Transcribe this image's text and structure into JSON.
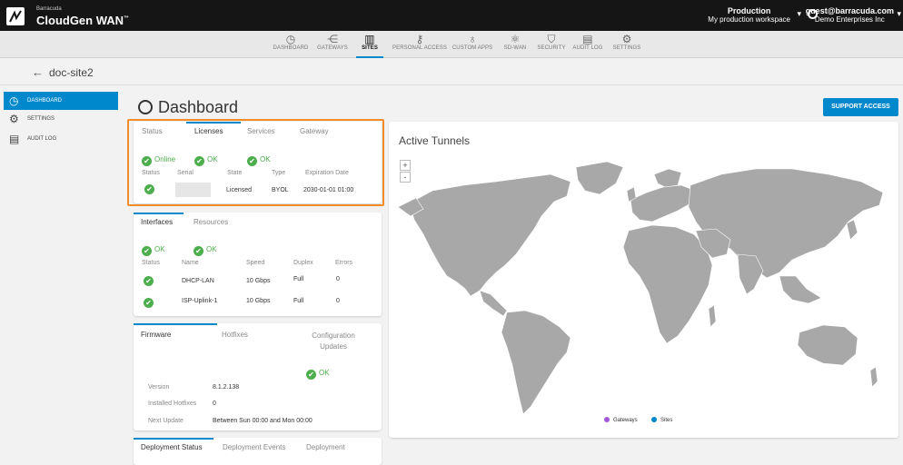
{
  "app": {
    "brand_small": "Barracuda",
    "name": "CloudGen WAN",
    "trademark": "™"
  },
  "workspace": {
    "title": "Production",
    "subtitle": "My production workspace"
  },
  "user": {
    "email": "guest@barracuda.com",
    "org": "Demo Enterprises Inc"
  },
  "nav": [
    {
      "label": "DASHBOARD",
      "icon": "gauge-icon",
      "glyph": "◷"
    },
    {
      "label": "GATEWAYS",
      "icon": "network-icon",
      "glyph": "⋲"
    },
    {
      "label": "SITES",
      "icon": "building-icon",
      "glyph": "▥",
      "active": true
    },
    {
      "label": "PERSONAL ACCESS",
      "icon": "user-key-icon",
      "glyph": "⚷"
    },
    {
      "label": "CUSTOM APPS",
      "icon": "app-icon",
      "glyph": "♁"
    },
    {
      "label": "SD-WAN",
      "icon": "sdwan-icon",
      "glyph": "⚛"
    },
    {
      "label": "SECURITY",
      "icon": "shield-icon",
      "glyph": "⛉"
    },
    {
      "label": "AUDIT LOG",
      "icon": "log-icon",
      "glyph": "▤"
    },
    {
      "label": "SETTINGS",
      "icon": "gear-icon",
      "glyph": "⚙"
    }
  ],
  "breadcrumb": {
    "back_glyph": "←",
    "site": "doc-site2"
  },
  "sidebar": [
    {
      "label": "DASHBOARD",
      "glyph": "◷",
      "active": true
    },
    {
      "label": "SETTINGS",
      "glyph": "⚙"
    },
    {
      "label": "AUDIT LOG",
      "glyph": "▤"
    }
  ],
  "page": {
    "title": "Dashboard",
    "support_button": "SUPPORT ACCESS"
  },
  "status_card": {
    "tabs": [
      "Status",
      "Licenses",
      "Services",
      "Gateway"
    ],
    "status_values": [
      "Online",
      "OK",
      "OK"
    ],
    "table_headers": [
      "Status",
      "Serial",
      "State",
      "Type",
      "Expiration Date"
    ],
    "row": {
      "state": "Licensed",
      "type": "BYOL",
      "expiration": "2030-01-01 01:00"
    }
  },
  "interfaces_card": {
    "tabs": [
      "Interfaces",
      "Resources"
    ],
    "status_values": [
      "OK",
      "OK"
    ],
    "table_headers": [
      "Status",
      "Name",
      "Speed",
      "Duplex",
      "Errors"
    ],
    "rows": [
      {
        "name": "DHCP-LAN",
        "speed": "10 Gbps",
        "duplex": "Full",
        "errors": "0"
      },
      {
        "name": "ISP-Uplink-1",
        "speed": "10 Gbps",
        "duplex": "Full",
        "errors": "0"
      }
    ]
  },
  "firmware_card": {
    "tabs": [
      "Firmware",
      "Hotfixes",
      "Configuration Updates"
    ],
    "status_value": "OK",
    "fields": [
      {
        "label": "Version",
        "value": "8.1.2.138"
      },
      {
        "label": "Installed Hotfixes",
        "value": "0"
      },
      {
        "label": "Next Update",
        "value": "Between Sun 00:00 and Mon 00:00"
      }
    ]
  },
  "deployment_card": {
    "tabs": [
      "Deployment Status",
      "Deployment Events",
      "Deployment"
    ]
  },
  "map": {
    "title": "Active Tunnels",
    "zoom_in": "+",
    "zoom_out": "-",
    "legend": [
      {
        "label": "Gateways",
        "color": "#a259d9"
      },
      {
        "label": "Sites",
        "color": "#0088cc"
      }
    ],
    "land_color": "#a8a8a8"
  },
  "colors": {
    "accent": "#0088cc",
    "ok": "#4cae4c",
    "highlight": "#f28c28"
  }
}
